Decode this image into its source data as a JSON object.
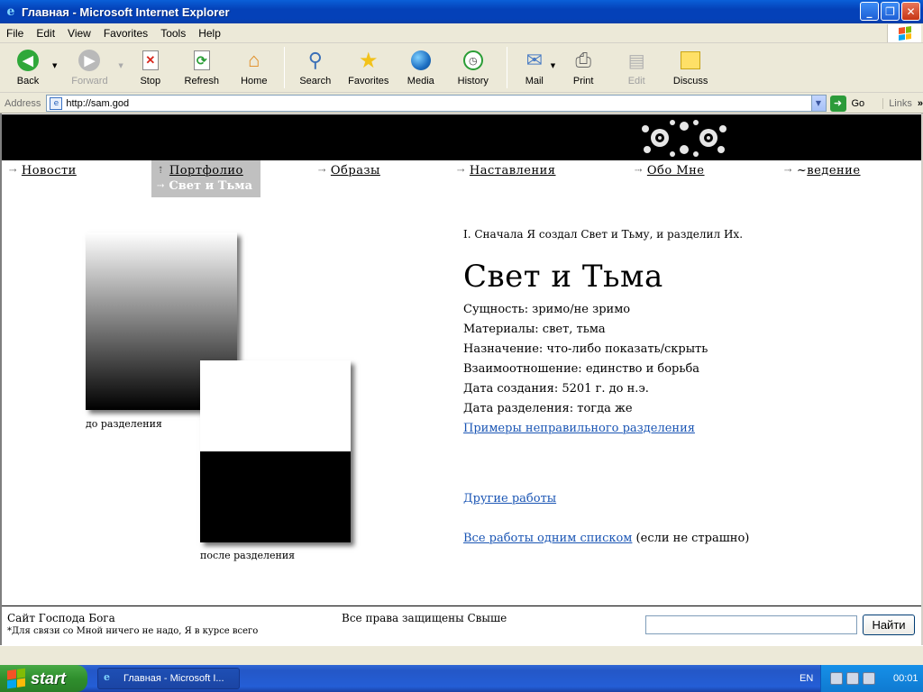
{
  "window": {
    "title": "Главная - Microsoft Internet Explorer",
    "controls": {
      "minimize": "_",
      "restore": "❐",
      "close": "✕"
    }
  },
  "menu": [
    "File",
    "Edit",
    "View",
    "Favorites",
    "Tools",
    "Help"
  ],
  "toolbar": {
    "back": "Back",
    "forward": "Forward",
    "stop": "Stop",
    "refresh": "Refresh",
    "home": "Home",
    "search": "Search",
    "favorites": "Favorites",
    "media": "Media",
    "history": "History",
    "mail": "Mail",
    "print": "Print",
    "edit": "Edit",
    "discuss": "Discuss"
  },
  "address": {
    "label": "Address",
    "url": "http://sam.god",
    "go": "Go",
    "links": "Links"
  },
  "nav": {
    "items": [
      {
        "label": "Новости"
      },
      {
        "label": "Портфолио"
      },
      {
        "label": "Образы"
      },
      {
        "label": "Наставления"
      },
      {
        "label": "Обо Мне"
      },
      {
        "prefix": "~",
        "label": "ведение"
      }
    ],
    "active_sub": "Свет и Тьма"
  },
  "artwork": {
    "caption_before": "до разделения",
    "caption_after": "после разделения"
  },
  "info": {
    "intro": "I. Сначала Я создал Свет и Тьму, и разделил Их.",
    "title": "Свет и Тьма",
    "properties": [
      "Сущность: зримо/не зримо",
      "Материалы: свет, тьма",
      "Назначение: что-либо показать/скрыть",
      "Взаимоотношение: единство и борьба",
      "Дата создания: 5201 г. до н.э.",
      "Дата разделения: тогда же"
    ],
    "link_examples": "Примеры неправильного разделения",
    "link_other": "Другие работы",
    "link_all": "Все работы одним списком",
    "link_all_suffix": " (если не страшно)"
  },
  "footer": {
    "site": "Сайт Господа Бога",
    "note": "*Для связи со Мной ничего не надо, Я в курсе всего",
    "rights": "Все права защищены Свыше",
    "search_value": "",
    "search_button": "Найти"
  },
  "taskbar": {
    "start": "start",
    "task": "Главная - Microsoft I...",
    "lang": "EN",
    "clock": "00:01"
  },
  "colors": {
    "link": "#1a55b4",
    "nav_active_bg": "#c0c0c0",
    "title_bar": "#0441b8",
    "taskbar": "#245ed6",
    "start_green": "#2f8f2d"
  }
}
